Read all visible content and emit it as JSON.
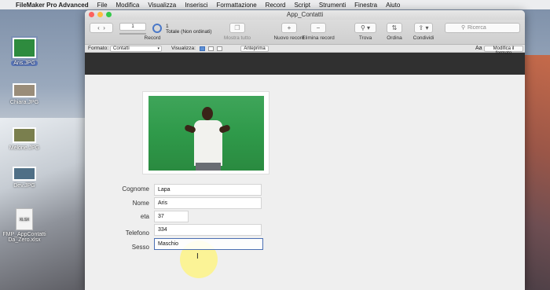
{
  "menubar": {
    "app": "FileMaker Pro Advanced",
    "items": [
      "File",
      "Modifica",
      "Visualizza",
      "Inserisci",
      "Formattazione",
      "Record",
      "Script",
      "Strumenti",
      "Finestra",
      "Aiuto"
    ]
  },
  "desktop": {
    "items": [
      {
        "label": "Aris.JPG"
      },
      {
        "label": "Chiara.JPG"
      },
      {
        "label": "Melone.JPG"
      },
      {
        "label": "Dev.JPG"
      },
      {
        "label": "FMP_AppContatti_Da_Zero.xlsx",
        "line1": "FMP_AppContatti",
        "line2": "Da_Zero.xlsx",
        "badge": "XLSX"
      }
    ]
  },
  "window": {
    "title": "App_Contatti",
    "toolbar": {
      "record_number": "1",
      "total_count": "1",
      "total_status": "Totale (Non ordinati)",
      "labels": {
        "record": "Record",
        "mostra_tutto": "Mostra tutto",
        "nuovo_record": "Nuovo record",
        "elimina_record": "Elimina record",
        "trova": "Trova",
        "ordina": "Ordina",
        "condividi": "Condividi"
      },
      "search_placeholder": "Ricerca"
    },
    "layoutbar": {
      "formato_label": "Formato:",
      "formato_value": "Contatti",
      "visualizza_label": "Visualizza:",
      "anteprima": "Anteprima",
      "aa": "Aa",
      "modifica_formato": "Modifica il formato"
    },
    "form": {
      "fields": [
        {
          "label": "Cognome",
          "value": "Lapa"
        },
        {
          "label": "Nome",
          "value": "Aris"
        },
        {
          "label": "eta",
          "value": "37"
        },
        {
          "label": "Telefono",
          "value": "334"
        },
        {
          "label": "Sesso",
          "value": "Maschio"
        }
      ]
    }
  }
}
